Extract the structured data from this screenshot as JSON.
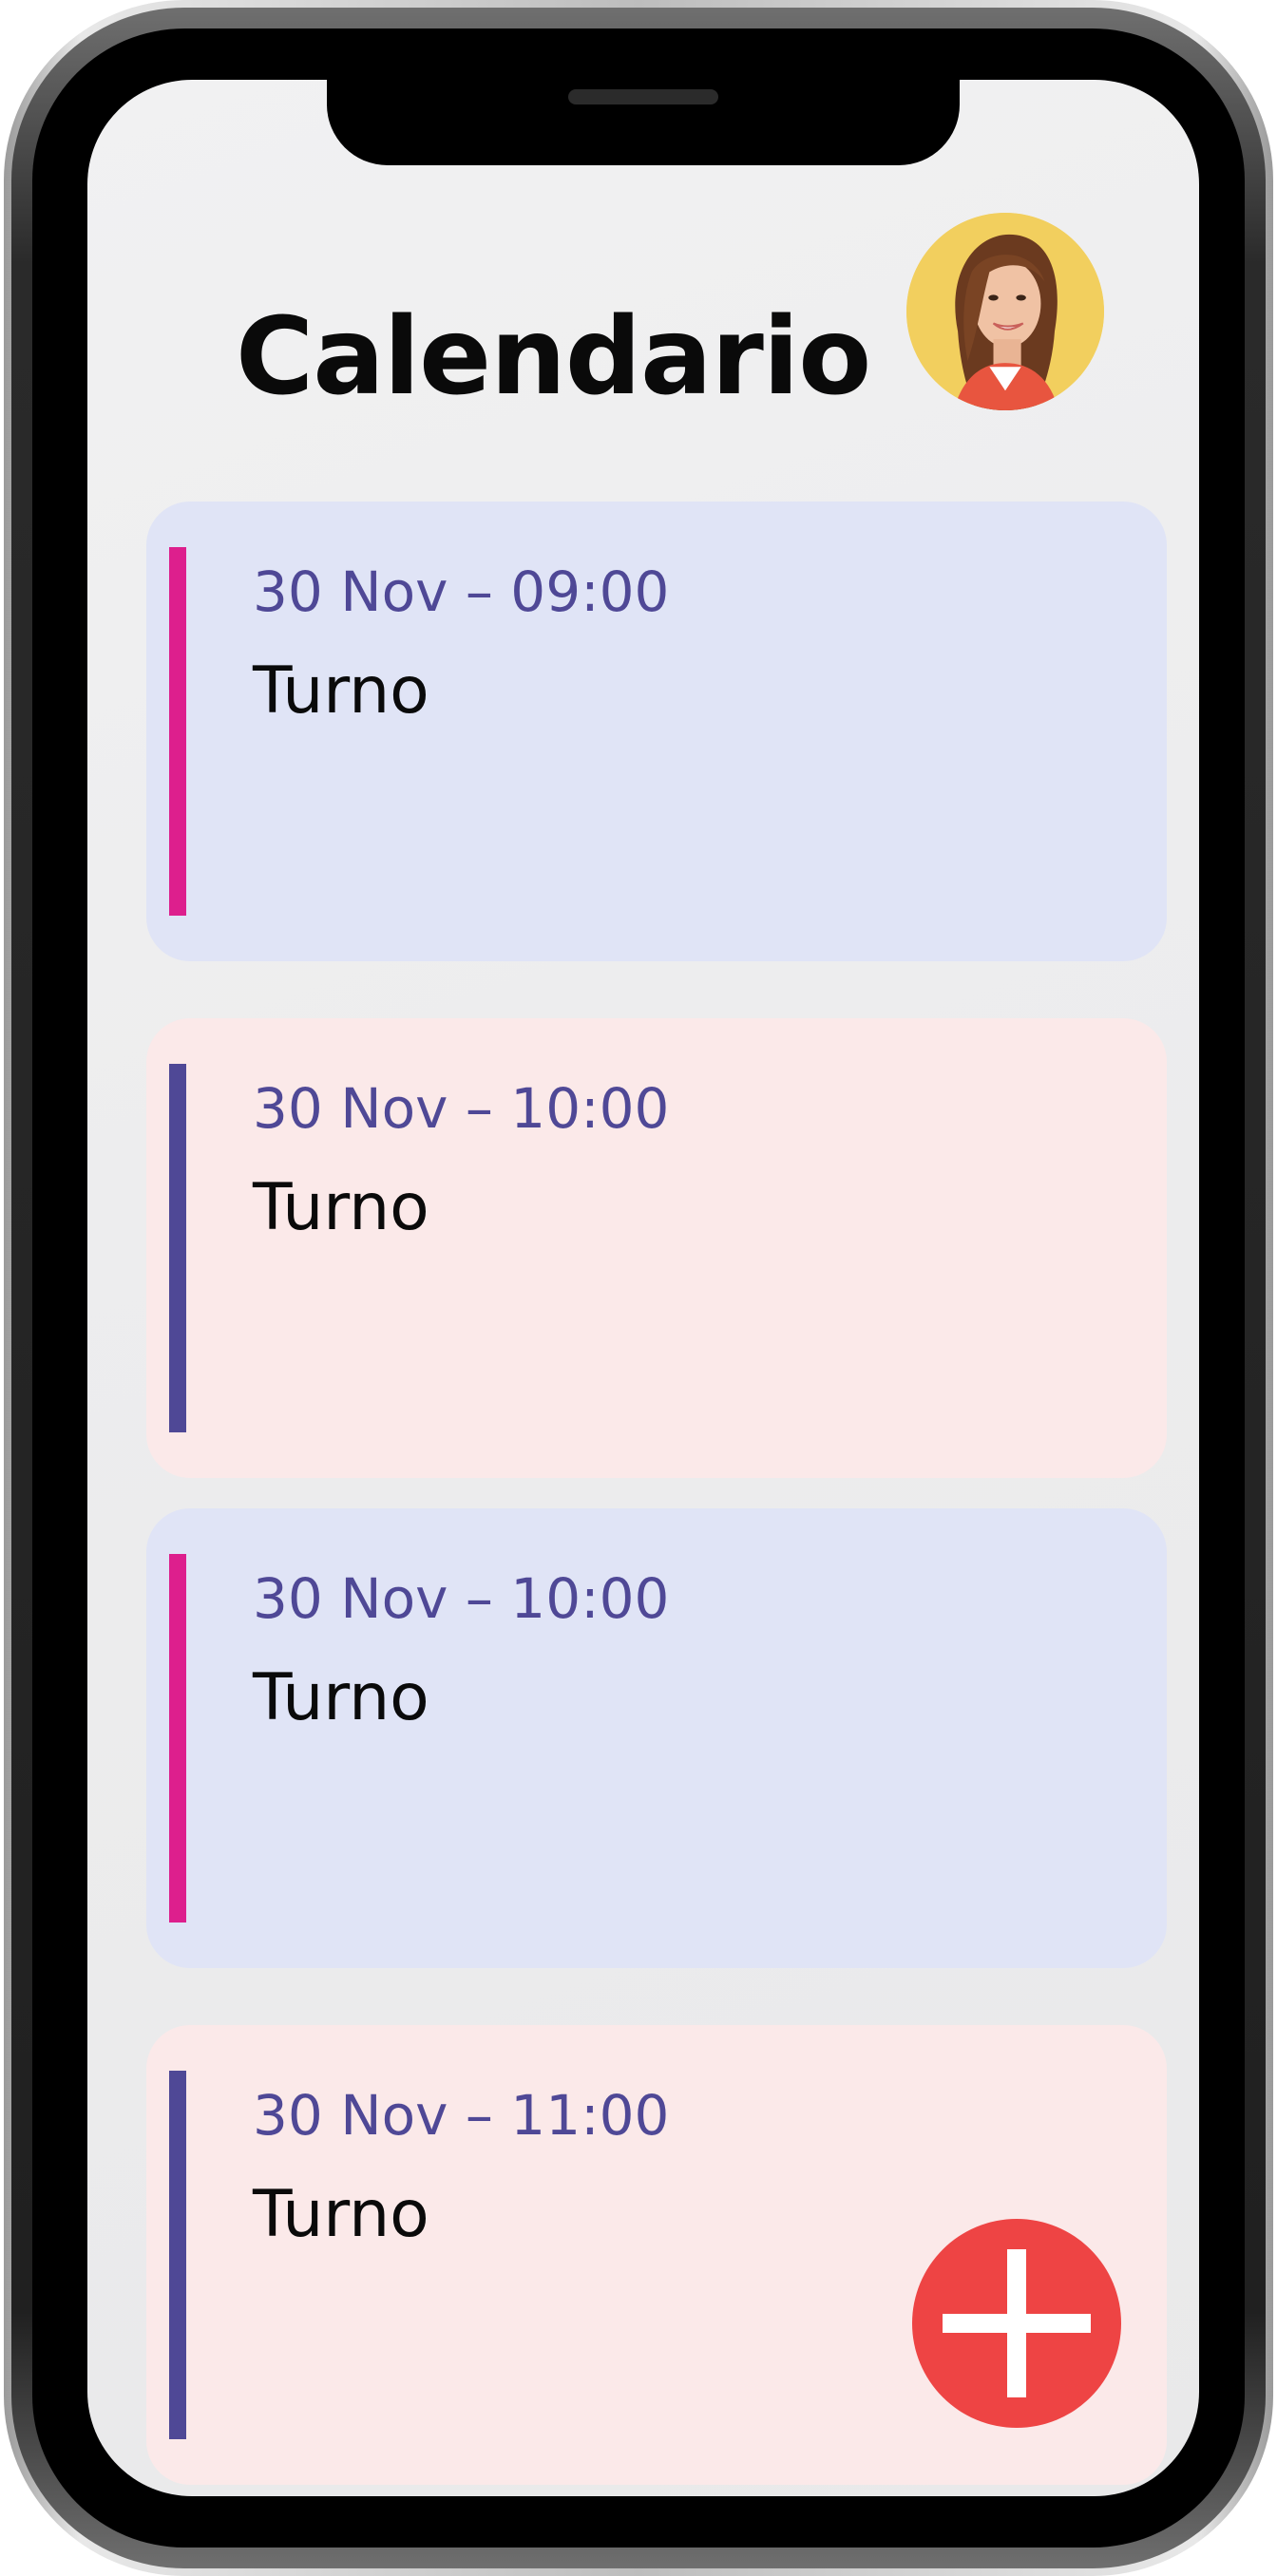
{
  "header": {
    "title": "Calendario"
  },
  "user": {
    "avatar_icon": "user-avatar"
  },
  "appointments": [
    {
      "datetime": "30 Nov – 09:00",
      "title": "Turno",
      "accent_color": "#dd1f8d",
      "background": "#e0e4f6"
    },
    {
      "datetime": "30 Nov – 10:00",
      "title": "Turno",
      "accent_color": "#4f4896",
      "background": "#fbe9e9"
    },
    {
      "datetime": "30 Nov – 10:00",
      "title": "Turno",
      "accent_color": "#dd1f8d",
      "background": "#e0e4f6"
    },
    {
      "datetime": "30 Nov – 11:00",
      "title": "Turno",
      "accent_color": "#4f4896",
      "background": "#fbe9e9"
    }
  ],
  "actions": {
    "add_icon": "plus-icon",
    "add_color": "#ee4444"
  }
}
